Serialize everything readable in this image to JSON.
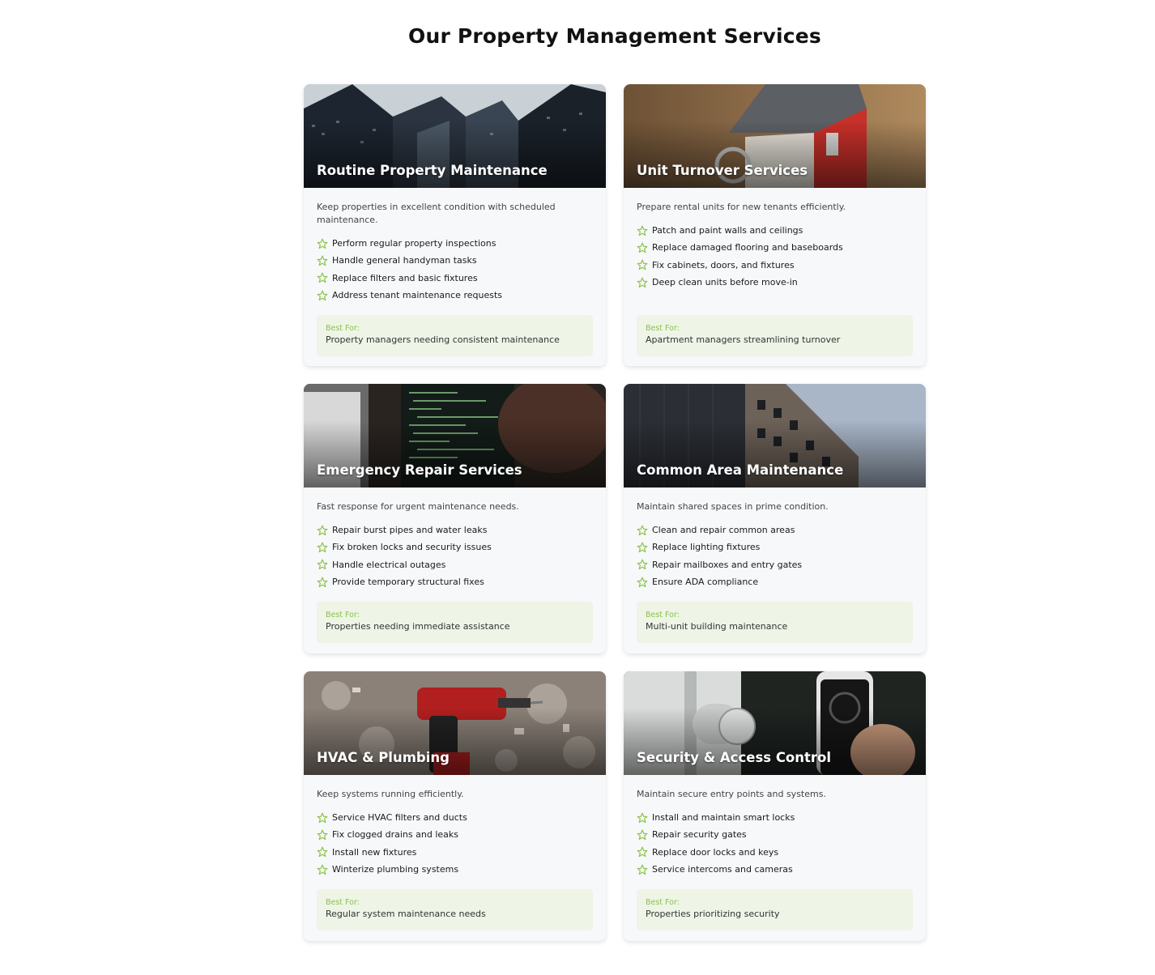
{
  "page": {
    "title": "Our Property Management Services"
  },
  "colors": {
    "accent": "#8bc34a",
    "card_bg": "#f7f8fa",
    "best_bg": "#eef4e6"
  },
  "best_for_label": "Best For:",
  "services": [
    {
      "title": "Routine Property Maintenance",
      "description": "Keep properties in excellent condition with scheduled maintenance.",
      "features": [
        "Perform regular property inspections",
        "Handle general handyman tasks",
        "Replace filters and basic fixtures",
        "Address tenant maintenance requests"
      ],
      "best_for": "Property managers needing consistent maintenance",
      "image": "skyscrapers-photo"
    },
    {
      "title": "Unit Turnover Services",
      "description": "Prepare rental units for new tenants efficiently.",
      "features": [
        "Patch and paint walls and ceilings",
        "Replace damaged flooring and baseboards",
        "Fix cabinets, doors, and fixtures",
        "Deep clean units before move-in"
      ],
      "best_for": "Apartment managers streamlining turnover",
      "image": "house-model-photo"
    },
    {
      "title": "Emergency Repair Services",
      "description": "Fast response for urgent maintenance needs.",
      "features": [
        "Repair burst pipes and water leaks",
        "Fix broken locks and security issues",
        "Handle electrical outages",
        "Provide temporary structural fixes"
      ],
      "best_for": "Properties needing immediate assistance",
      "image": "code-monitor-photo"
    },
    {
      "title": "Common Area Maintenance",
      "description": "Maintain shared spaces in prime condition.",
      "features": [
        "Clean and repair common areas",
        "Replace lighting fixtures",
        "Repair mailboxes and entry gates",
        "Ensure ADA compliance"
      ],
      "best_for": "Multi-unit building maintenance",
      "image": "apartment-building-photo"
    },
    {
      "title": "HVAC & Plumbing",
      "description": "Keep systems running efficiently.",
      "features": [
        "Service HVAC filters and ducts",
        "Fix clogged drains and leaks",
        "Install new fixtures",
        "Winterize plumbing systems"
      ],
      "best_for": "Regular system maintenance needs",
      "image": "power-drill-photo"
    },
    {
      "title": "Security & Access Control",
      "description": "Maintain secure entry points and systems.",
      "features": [
        "Install and maintain smart locks",
        "Repair security gates",
        "Replace door locks and keys",
        "Service intercoms and cameras"
      ],
      "best_for": "Properties prioritizing security",
      "image": "smart-lock-photo"
    }
  ]
}
